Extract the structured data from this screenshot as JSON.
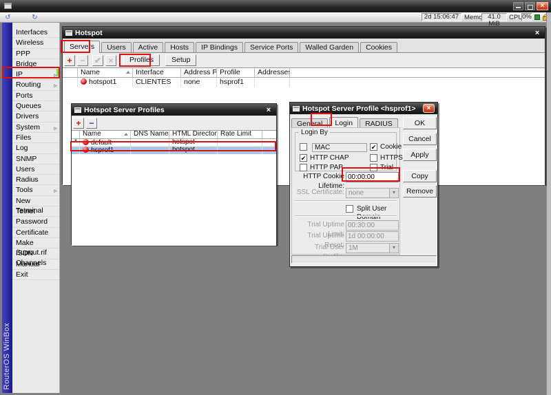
{
  "app": {
    "stats": {
      "uptime": "2d 15:06:47",
      "memory_label": "Memory:",
      "memory": "41.0 MiB",
      "cpu_label": "CPU:",
      "cpu": "0%"
    },
    "brand": "RouterOS WinBox"
  },
  "icons": {
    "undo": "↺",
    "redo": "↻",
    "close": "×",
    "dropdown": "▾",
    "plus": "+",
    "minus": "−",
    "check": "✔",
    "cross": "×",
    "submenu": "▹"
  },
  "sidebar": {
    "items": [
      {
        "label": "Interfaces",
        "arrow": ""
      },
      {
        "label": "Wireless",
        "arrow": ""
      },
      {
        "label": "PPP",
        "arrow": ""
      },
      {
        "label": "Bridge",
        "arrow": ""
      },
      {
        "label": "IP",
        "arrow": "▹"
      },
      {
        "label": "Routing",
        "arrow": "▹"
      },
      {
        "label": "Ports",
        "arrow": ""
      },
      {
        "label": "Queues",
        "arrow": ""
      },
      {
        "label": "Drivers",
        "arrow": ""
      },
      {
        "label": "System",
        "arrow": "▹"
      },
      {
        "label": "Files",
        "arrow": ""
      },
      {
        "label": "Log",
        "arrow": ""
      },
      {
        "label": "SNMP",
        "arrow": ""
      },
      {
        "label": "Users",
        "arrow": ""
      },
      {
        "label": "Radius",
        "arrow": ""
      },
      {
        "label": "Tools",
        "arrow": "▹"
      },
      {
        "label": "New Terminal",
        "arrow": ""
      },
      {
        "label": "Telnet",
        "arrow": ""
      },
      {
        "label": "Password",
        "arrow": ""
      },
      {
        "label": "Certificate",
        "arrow": ""
      },
      {
        "label": "Make Supout.rif",
        "arrow": ""
      },
      {
        "label": "ISDN Channels",
        "arrow": ""
      },
      {
        "label": "Manual",
        "arrow": ""
      },
      {
        "label": "Exit",
        "arrow": ""
      }
    ]
  },
  "hotspot_window": {
    "title": "Hotspot",
    "active_tab": "Servers",
    "tabs": [
      {
        "label": "Servers"
      },
      {
        "label": "Users"
      },
      {
        "label": "Active"
      },
      {
        "label": "Hosts"
      },
      {
        "label": "IP Bindings"
      },
      {
        "label": "Service Ports"
      },
      {
        "label": "Walled Garden"
      },
      {
        "label": "Cookies"
      }
    ],
    "toolbar": {
      "profiles_label": "Profiles",
      "setup_label": "Setup"
    },
    "table": {
      "headers": [
        "Name",
        "Interface",
        "Address Pool",
        "Profile",
        "Addresses ..."
      ],
      "rows": [
        {
          "name": "hotspot1",
          "interface": "CLIENTES",
          "address_pool": "none",
          "profile": "hsprof1"
        }
      ]
    }
  },
  "profiles_window": {
    "title": "Hotspot Server Profiles",
    "table": {
      "headers": [
        "Name",
        "DNS Name",
        "HTML Directory",
        "Rate Limit"
      ],
      "rows": [
        {
          "flag": "*",
          "name": "default",
          "dns_name": "",
          "html_directory": "hotspot",
          "rate_limit": ""
        },
        {
          "flag": "",
          "name": "hsprof1",
          "dns_name": "",
          "html_directory": "hotspot",
          "rate_limit": "",
          "selected": "true"
        }
      ]
    }
  },
  "profile_dialog": {
    "title": "Hotspot Server Profile <hsprof1>",
    "active_tab": "Login",
    "tabs": [
      {
        "label": "General"
      },
      {
        "label": "Login"
      },
      {
        "label": "RADIUS"
      }
    ],
    "buttons": [
      {
        "label": "OK"
      },
      {
        "label": "Cancel"
      },
      {
        "label": "Apply"
      },
      {
        "label": "Copy"
      },
      {
        "label": "Remove"
      }
    ],
    "login_by": {
      "legend": "Login By",
      "checkboxes": [
        {
          "label": "MAC",
          "mark": ""
        },
        {
          "label": "Cookie",
          "mark": "✔"
        },
        {
          "label": "HTTP CHAP",
          "mark": "✔"
        },
        {
          "label": "HTTPS",
          "mark": ""
        },
        {
          "label": "HTTP PAP",
          "mark": ""
        },
        {
          "label": "Trial",
          "mark": ""
        }
      ]
    },
    "fields": {
      "http_cookie_lifetime": {
        "label": "HTTP Cookie Lifetime:",
        "value": "00:00:00"
      },
      "ssl_certificate": {
        "label": "SSL Certificate:",
        "value": "none"
      },
      "split_user_domain": {
        "label": "Split User Domain",
        "mark": ""
      },
      "trial_uptime_limit": {
        "label": "Trial Uptime Limit:",
        "value": "00:30:00"
      },
      "trial_uptime_reset": {
        "label": "Trial Uptime Reset:",
        "value": "1d 00:00:00"
      },
      "trial_user_profile": {
        "label": "Trial User Profile:",
        "value": "1M"
      }
    }
  },
  "colors": {
    "annotation_red": "#dd1111",
    "selection_blue": "#aac8e8",
    "brand_strip_blue": "#2626a8",
    "titlebar_dark": "#2a2a2a",
    "add_red": "#cc1111",
    "remove_navy": "#333399",
    "status_green": "#2f8f2f"
  }
}
